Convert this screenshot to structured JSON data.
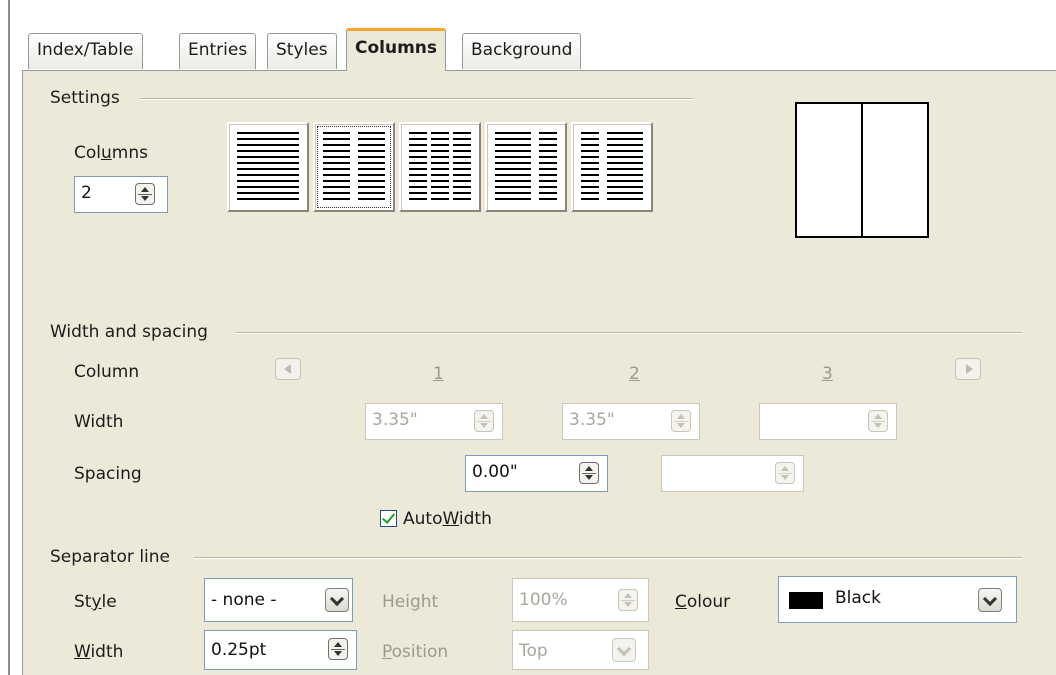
{
  "tabs": [
    {
      "label": "Index/Table",
      "active": false
    },
    {
      "label": "Entries",
      "active": false
    },
    {
      "label": "Styles",
      "active": false
    },
    {
      "label": "Columns",
      "active": true
    },
    {
      "label": "Background",
      "active": false
    }
  ],
  "settings": {
    "group_label": "Settings",
    "columns_label_pre": "Col",
    "columns_label_key": "u",
    "columns_label_post": "mns",
    "columns_value": "2",
    "presets": [
      "one-column",
      "two-columns",
      "three-columns",
      "two-columns-left",
      "two-columns-right"
    ],
    "selected_preset": "two-columns"
  },
  "width_spacing": {
    "group_label": "Width and spacing",
    "column_label": "Column",
    "column_numbers": [
      "1",
      "2",
      "3"
    ],
    "width_label": "Width",
    "width_values": [
      "3.35\"",
      "3.35\"",
      ""
    ],
    "spacing_label": "Spacing",
    "spacing_values": [
      "0.00\"",
      ""
    ],
    "autowidth_pre": "Auto",
    "autowidth_key": "W",
    "autowidth_post": "idth",
    "autowidth_checked": true
  },
  "separator": {
    "group_label": "Separator line",
    "style_pre": "St",
    "style_key": "y",
    "style_post": "le",
    "style_value": "- none -",
    "height_pre": "Hei",
    "height_key": "g",
    "height_post": "ht",
    "height_value": "100%",
    "colour_key": "C",
    "colour_post": "olour",
    "colour_value": "Black",
    "colour_swatch": "#000000",
    "width_key": "W",
    "width_post": "idth",
    "width_value": "0.25pt",
    "position_key": "P",
    "position_post": "osition",
    "position_value": "Top"
  },
  "colors": {
    "panel_bg": "#ece9d8",
    "active_tab_accent": "#f2a52c",
    "check_mark": "#21a121"
  }
}
